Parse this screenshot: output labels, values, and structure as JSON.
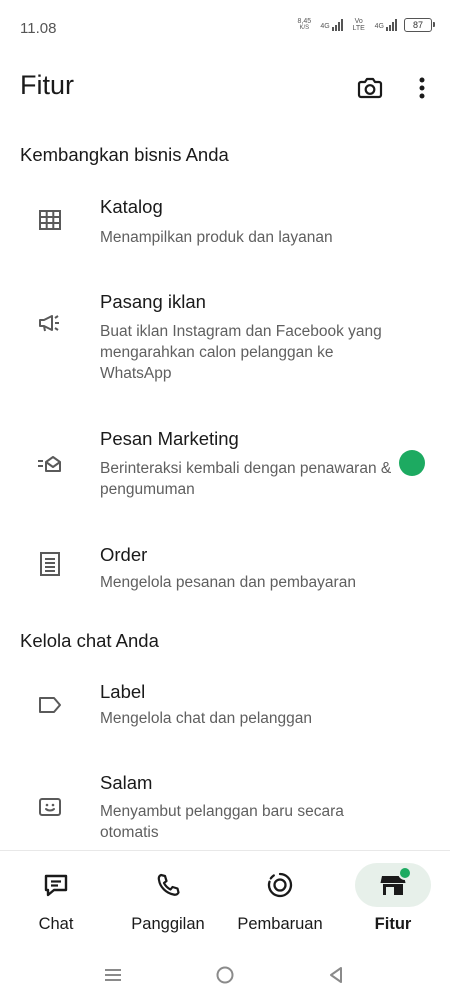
{
  "status_bar": {
    "time": "11.08",
    "net_speed_value": "8,45",
    "net_speed_unit": "K/S",
    "signal1_label": "4G",
    "volte_label_top": "Vo",
    "volte_label_bottom": "LTE",
    "signal2_label": "4G",
    "battery": "87"
  },
  "header": {
    "title": "Fitur",
    "icons": [
      "camera-icon",
      "more-vert-icon"
    ]
  },
  "sections": [
    {
      "title": "Kembangkan bisnis Anda",
      "items": [
        {
          "title": "Katalog",
          "description": "Menampilkan produk dan layanan",
          "icon": "catalog-grid-icon"
        },
        {
          "title": "Pasang iklan",
          "description": "Buat iklan Instagram dan Facebook yang mengarahkan calon pelanggan ke WhatsApp",
          "icon": "megaphone-icon"
        },
        {
          "title": "Pesan Marketing",
          "description": "Berinteraksi kembali dengan penawaran & pengumuman",
          "icon": "marketing-message-icon",
          "has_badge": true
        },
        {
          "title": "Order",
          "description": "Mengelola pesanan dan pembayaran",
          "icon": "order-receipt-icon"
        }
      ]
    },
    {
      "title": "Kelola chat Anda",
      "items": [
        {
          "title": "Label",
          "description": "Mengelola chat dan pelanggan",
          "icon": "label-tag-icon"
        },
        {
          "title": "Salam",
          "description": "Menyambut pelanggan baru secara otomatis",
          "icon": "greeting-icon"
        }
      ]
    }
  ],
  "bottom_nav": {
    "items": [
      {
        "label": "Chat",
        "icon": "chat-icon",
        "active": false
      },
      {
        "label": "Panggilan",
        "icon": "phone-icon",
        "active": false
      },
      {
        "label": "Pembaruan",
        "icon": "updates-icon",
        "active": false
      },
      {
        "label": "Fitur",
        "icon": "storefront-icon",
        "active": true,
        "has_badge": true
      }
    ]
  },
  "system_nav": [
    "menu-icon",
    "home-circle-icon",
    "back-triangle-icon"
  ],
  "colors": {
    "accent": "#1daa61",
    "active_pill": "#e7f0ea",
    "text_primary": "#1a1a1a",
    "text_secondary": "#5f5f5f"
  }
}
